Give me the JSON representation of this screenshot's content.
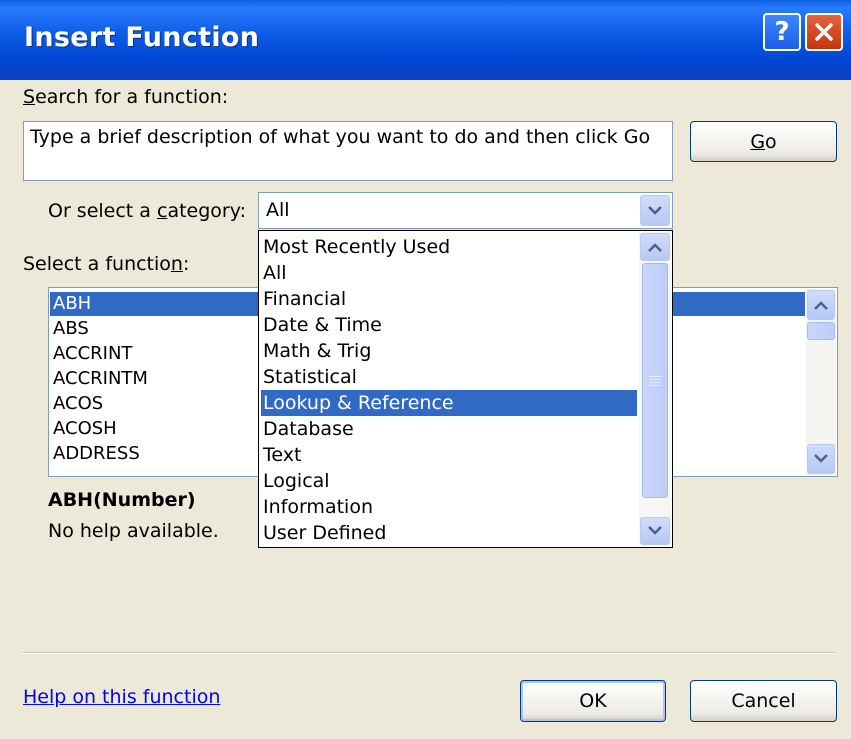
{
  "window": {
    "title": "Insert Function",
    "help_button": "?"
  },
  "search": {
    "label_pre": "",
    "label_accel": "S",
    "label_post": "earch for a function:",
    "text": "Type a brief description of what you want to do and then click Go",
    "go_accel": "G",
    "go_post": "o"
  },
  "category": {
    "label_pre": "Or select a ",
    "label_accel": "c",
    "label_post": "ategory:",
    "value": "All",
    "options": [
      "Most Recently Used",
      "All",
      "Financial",
      "Date & Time",
      "Math & Trig",
      "Statistical",
      "Lookup & Reference",
      "Database",
      "Text",
      "Logical",
      "Information",
      "User Defined"
    ],
    "highlighted": "Lookup & Reference"
  },
  "function_list": {
    "label_pre": "Select a functio",
    "label_accel": "n",
    "label_post": ":",
    "items": [
      "ABH",
      "ABS",
      "ACCRINT",
      "ACCRINTM",
      "ACOS",
      "ACOSH",
      "ADDRESS"
    ],
    "selected": "ABH"
  },
  "details": {
    "signature": "ABH(Number)",
    "description": "No help available."
  },
  "footer": {
    "help_link": "Help on this function",
    "ok_label": "OK",
    "cancel_label": "Cancel"
  },
  "colors": {
    "selection": "#316ac5",
    "title_bar": "#0a5fe0",
    "dialog_background": "#ece9d8"
  }
}
